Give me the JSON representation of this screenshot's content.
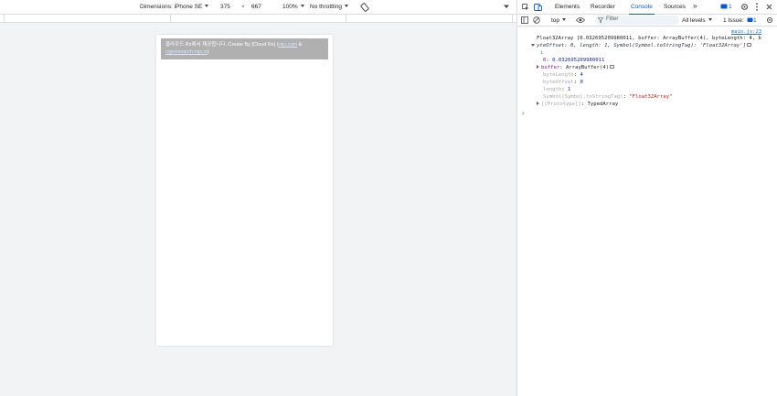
{
  "device_toolbar": {
    "dimensions_label": "Dimensions: iPhone SE",
    "width": "375",
    "times": "×",
    "height": "667",
    "zoom": "100%",
    "throttling": "No throttling"
  },
  "page": {
    "banner_text": "클라우드 Rx에서 제공합니다. Create By [Cloud Rx] (",
    "banner_link1": "rxjs.com",
    "banner_amp": " &",
    "banner_link2": "rxjsresearch.rxjs.io",
    "banner_end": ")"
  },
  "devtools": {
    "tabs": [
      "Elements",
      "Recorder",
      "Console",
      "Sources"
    ],
    "active_tab": "Console",
    "more_tabs": "»",
    "message_count": "1",
    "context": "top",
    "filter_placeholder": "Filter",
    "levels": "All levels",
    "issues_label": "1 Issue:",
    "issues_count": "1"
  },
  "console": {
    "source_link": "main.js:23",
    "line1": "Float32Array [0.032695209980011, buffer: ArrayBuffer(4), byteLength: 4, b",
    "line2_rest": "yteOffset: 0, length: 1, Symbol(Symbol.toStringTag): 'Float32Array']",
    "info_i": "i",
    "entries": [
      {
        "key": "0",
        "sep": ": ",
        "value": "0.032695209980011"
      },
      {
        "key": "buffer",
        "sep": ": ",
        "value": "ArrayBuffer(4)"
      },
      {
        "key": "byteLength",
        "sep": ": ",
        "value": "4"
      },
      {
        "key": "byteOffset",
        "sep": ": ",
        "value": "0"
      },
      {
        "key": "length",
        "sep": ": ",
        "value": "1"
      },
      {
        "key": "Symbol(Symbol.toStringTag)",
        "sep": ": ",
        "value": "\"Float32Array\""
      },
      {
        "key": "[[Prototype]]",
        "sep": ": ",
        "value": "TypedArray"
      }
    ],
    "prompt": "›"
  },
  "colors": {
    "accent": "#0b57d0",
    "banner_bg": "#b0b0b0",
    "string": "#c41a16",
    "number": "#1a1aa6",
    "key": "#881280"
  }
}
